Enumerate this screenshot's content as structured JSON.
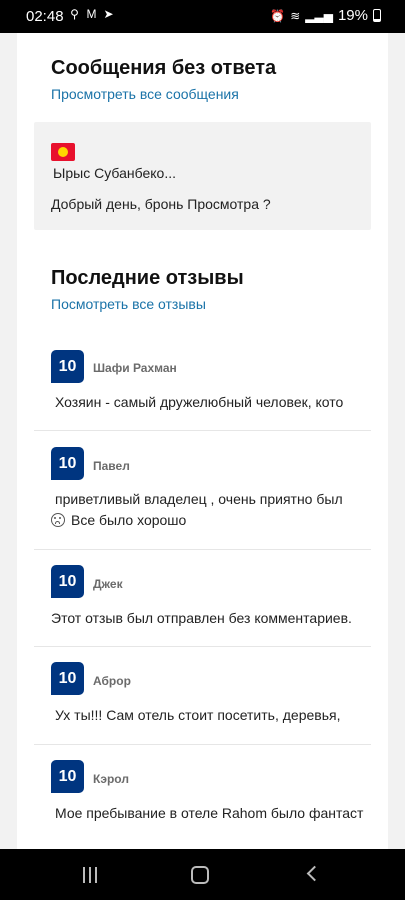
{
  "status_bar": {
    "time": "02:48",
    "icons_left": [
      "search-icon",
      "gmail-icon",
      "telegram-icon"
    ],
    "icons_right": [
      "alarm-icon",
      "wifi-icon",
      "signal-icon"
    ],
    "battery": "19%"
  },
  "unanswered": {
    "title": "Сообщения без ответа",
    "link": "Просмотреть все сообщения",
    "message": {
      "flag": "kyrgyzstan-flag-icon",
      "name": "Ырыс Субанбеко...",
      "text": "Добрый день, бронь Просмотра ?"
    }
  },
  "reviews": {
    "title": "Последние отзывы",
    "link": "Посмотреть все отзывы",
    "items": [
      {
        "score": "10",
        "name": "Шафи Рахман",
        "text": "Хозяин - самый дружелюбный человек, кото"
      },
      {
        "score": "10",
        "name": "Павел",
        "text": "приветливый владелец , очень приятно был",
        "subtext": "Все было хорошо"
      },
      {
        "score": "10",
        "name": "Джек",
        "text": "Этот отзыв был отправлен без комментариев."
      },
      {
        "score": "10",
        "name": "Аброр",
        "text": "Ух ты!!! Сам отель стоит посетить, деревья,"
      },
      {
        "score": "10",
        "name": "Кэрол",
        "text": "Мое пребывание в отеле Rahom было фантаст"
      }
    ]
  },
  "colors": {
    "score_badge": "#003580",
    "link": "#1a73a8",
    "background": "#f2f2f2"
  }
}
